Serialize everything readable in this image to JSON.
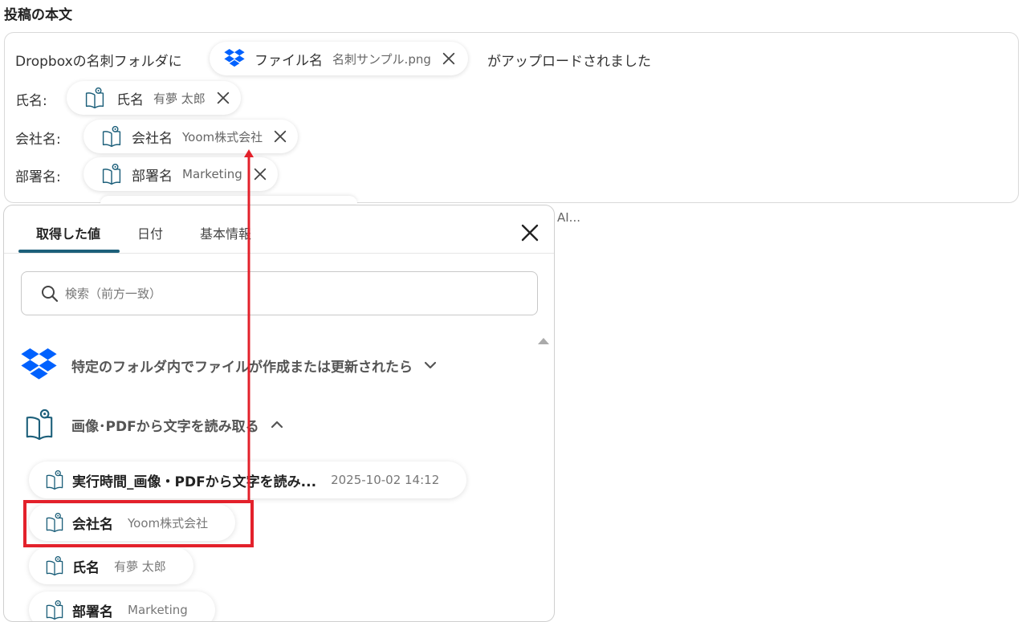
{
  "section_title": "投稿の本文",
  "editor": {
    "line1": {
      "before": "Dropboxの名刺フォルダに",
      "after": "がアップロードされました"
    },
    "chip_file": {
      "label": "ファイル名",
      "value": "名刺サンプル.png"
    },
    "line2_label": "氏名:",
    "chip_name": {
      "label": "氏名",
      "value": "有夢 太郎"
    },
    "line3_label": "会社名:",
    "chip_company": {
      "label": "会社名",
      "value": "Yoom株式会社"
    },
    "line4_label": "部署名:",
    "chip_dept": {
      "label": "部署名",
      "value": "Marketing"
    },
    "ai_hint": "AI..."
  },
  "panel": {
    "tabs": [
      {
        "label": "取得した値",
        "active": true
      },
      {
        "label": "日付",
        "active": false
      },
      {
        "label": "基本情報",
        "active": false
      }
    ],
    "search_placeholder": "検索（前方一致）",
    "groups": [
      {
        "title": "特定のフォルダ内でファイルが作成または更新されたら",
        "icon": "dropbox-icon",
        "expanded": false
      },
      {
        "title": "画像･PDFから文字を読み取る",
        "icon": "ocr-book-icon",
        "expanded": true
      }
    ],
    "items": [
      {
        "label": "実行時間_画像・PDFから文字を読み...",
        "value": "2025-10-02 14:12"
      },
      {
        "label": "会社名",
        "value": "Yoom株式会社"
      },
      {
        "label": "氏名",
        "value": "有夢 太郎"
      },
      {
        "label": "部署名",
        "value": "Marketing"
      }
    ]
  },
  "colors": {
    "accent": "#1c5f7a",
    "highlight": "#e3212b",
    "dropbox": "#0061fe"
  }
}
